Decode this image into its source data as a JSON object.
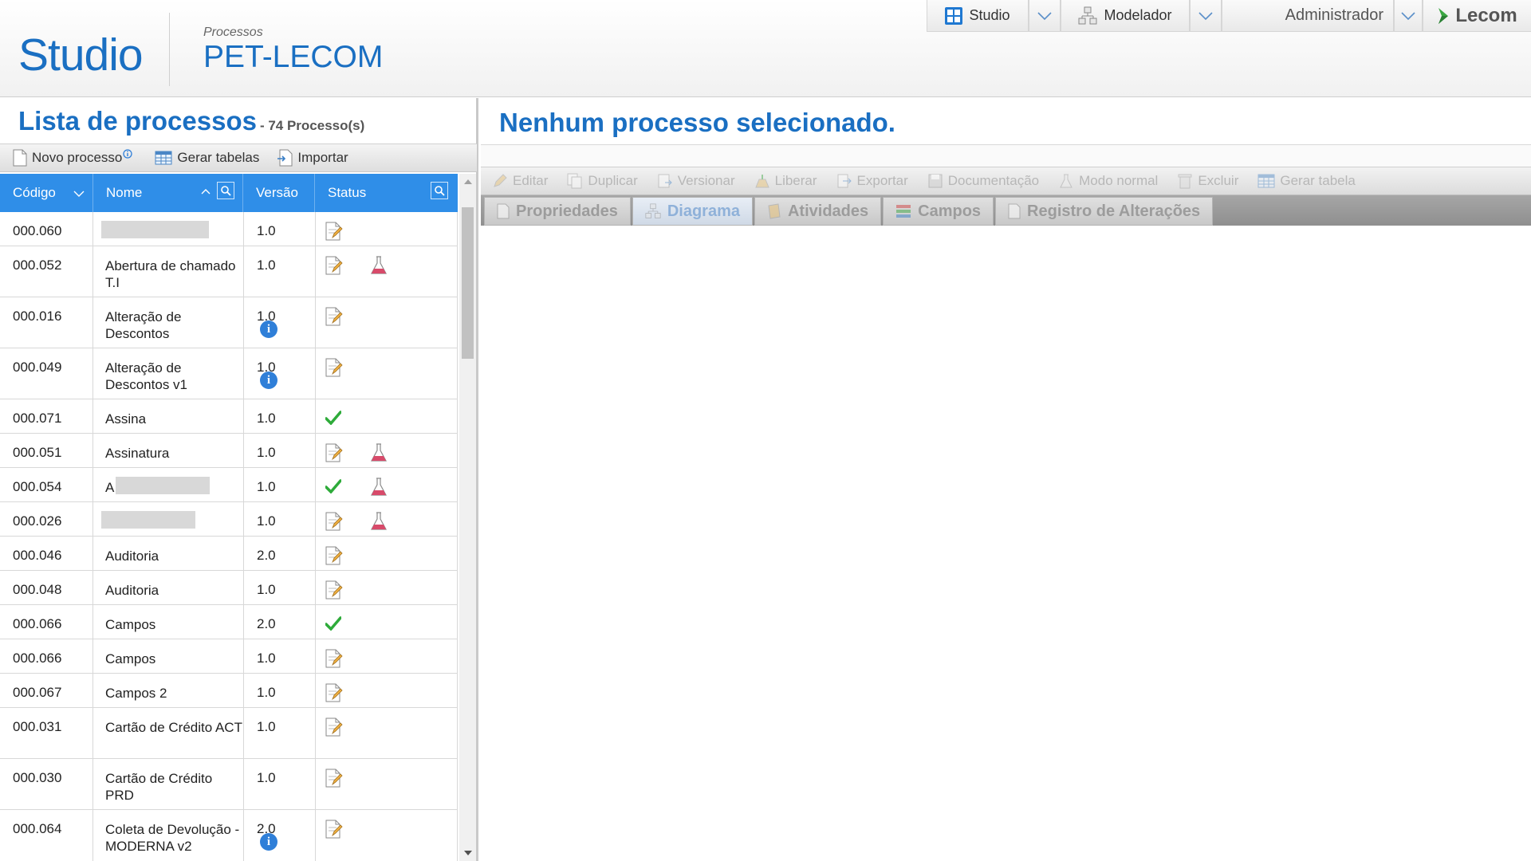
{
  "header": {
    "app_title": "Studio",
    "section_label": "Processos",
    "section_name": "PET-LECOM",
    "nav": {
      "studio_label": "Studio",
      "modelador_label": "Modelador",
      "user_label": "Administrador",
      "logo_text": "Lecom"
    }
  },
  "left": {
    "title": "Lista de processos",
    "count": "- 74 Processo(s)",
    "toolbar": {
      "new_label": "Novo processo",
      "tables_label": "Gerar tabelas",
      "import_label": "Importar"
    },
    "columns": {
      "code": "Código",
      "name": "Nome",
      "version": "Versão",
      "status": "Status"
    },
    "rows": [
      {
        "code": "000.060",
        "name": "",
        "version": "1.0"
      },
      {
        "code": "000.052",
        "name": "Abertura de chamado T.I",
        "version": "1.0"
      },
      {
        "code": "000.016",
        "name": "Alteração de Descontos",
        "version": "1.0"
      },
      {
        "code": "000.049",
        "name": "Alteração de Descontos v1",
        "version": "1.0"
      },
      {
        "code": "000.071",
        "name": "Assina",
        "version": "1.0"
      },
      {
        "code": "000.051",
        "name": "Assinatura",
        "version": "1.0"
      },
      {
        "code": "000.054",
        "name": "A",
        "version": "1.0"
      },
      {
        "code": "000.026",
        "name": "",
        "version": "1.0"
      },
      {
        "code": "000.046",
        "name": "Auditoria",
        "version": "2.0"
      },
      {
        "code": "000.048",
        "name": "Auditoria",
        "version": "1.0"
      },
      {
        "code": "000.066",
        "name": "Campos",
        "version": "2.0"
      },
      {
        "code": "000.066",
        "name": "Campos",
        "version": "1.0"
      },
      {
        "code": "000.067",
        "name": "Campos 2",
        "version": "1.0"
      },
      {
        "code": "000.031",
        "name": "Cartão de Crédito ACT",
        "version": "1.0"
      },
      {
        "code": "000.030",
        "name": "Cartão de Crédito PRD",
        "version": "1.0"
      },
      {
        "code": "000.064",
        "name": "Coleta de Devolução - MODERNA v2",
        "version": "2.0"
      }
    ]
  },
  "right": {
    "title": "Nenhum processo selecionado.",
    "toolbar": {
      "edit": "Editar",
      "duplicate": "Duplicar",
      "version": "Versionar",
      "release": "Liberar",
      "export": "Exportar",
      "docs": "Documentação",
      "mode": "Modo normal",
      "delete": "Excluir",
      "gen_table": "Gerar tabela"
    },
    "tabs": {
      "properties": "Propriedades",
      "diagram": "Diagrama",
      "activities": "Atividades",
      "fields": "Campos",
      "changelog": "Registro de Alterações"
    }
  },
  "colors": {
    "brand_blue": "#1a6fc2",
    "table_header": "#2f8ee8",
    "status_ok": "#2eab3a"
  },
  "icons": [
    "studio-grid-icon",
    "modelador-icon",
    "chevron-down-icon",
    "lecom-logo-icon",
    "new-doc-icon",
    "table-icon",
    "import-icon",
    "search-icon",
    "sort-icon",
    "edit-doc-icon",
    "flask-icon",
    "check-icon",
    "info-icon"
  ]
}
